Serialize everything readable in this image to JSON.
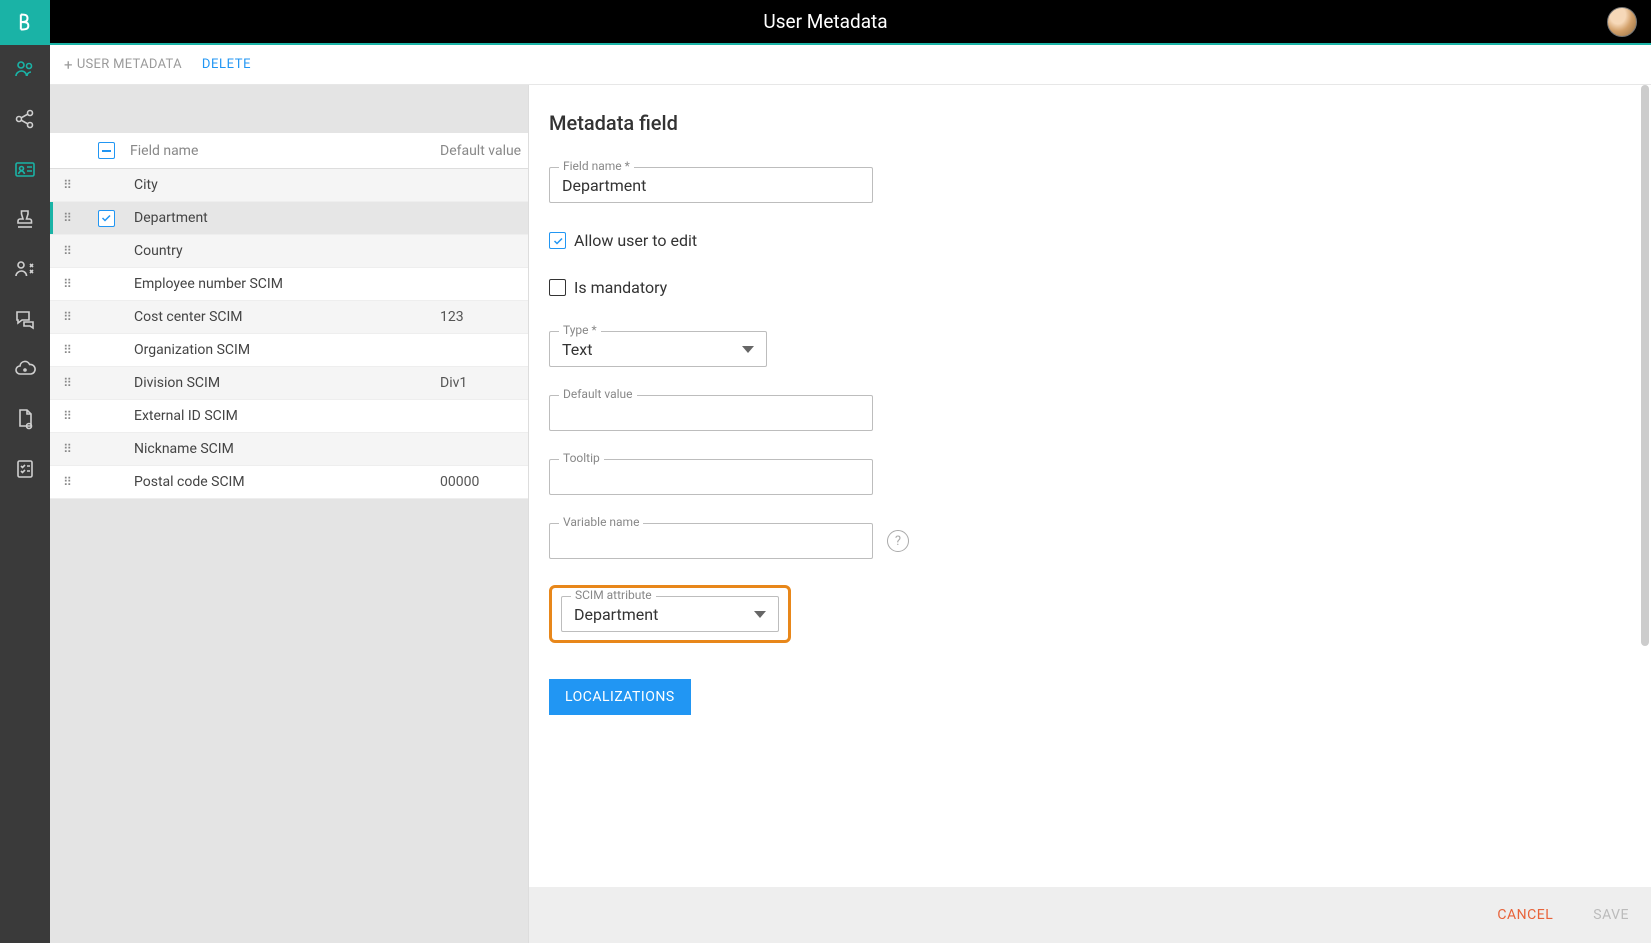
{
  "header": {
    "title": "User Metadata"
  },
  "toolbar": {
    "add_label": "USER METADATA",
    "delete_label": "DELETE"
  },
  "table": {
    "columns": {
      "field_name": "Field name",
      "default_value": "Default value"
    },
    "rows": [
      {
        "name": "City",
        "default": "",
        "selected": false
      },
      {
        "name": "Department",
        "default": "",
        "selected": true
      },
      {
        "name": "Country",
        "default": "",
        "selected": false
      },
      {
        "name": "Employee number SCIM",
        "default": "",
        "selected": false
      },
      {
        "name": "Cost center SCIM",
        "default": "123",
        "selected": false
      },
      {
        "name": "Organization SCIM",
        "default": "",
        "selected": false
      },
      {
        "name": "Division SCIM",
        "default": "Div1",
        "selected": false
      },
      {
        "name": "External ID SCIM",
        "default": "",
        "selected": false
      },
      {
        "name": "Nickname SCIM",
        "default": "",
        "selected": false
      },
      {
        "name": "Postal code SCIM",
        "default": "00000",
        "selected": false
      }
    ]
  },
  "detail": {
    "panel_title": "Metadata field",
    "field_name_label": "Field name *",
    "field_name_value": "Department",
    "allow_edit_label": "Allow user to edit",
    "allow_edit_checked": true,
    "is_mandatory_label": "Is mandatory",
    "is_mandatory_checked": false,
    "type_label": "Type *",
    "type_value": "Text",
    "default_value_label": "Default value",
    "default_value_value": "",
    "tooltip_label": "Tooltip",
    "tooltip_value": "",
    "variable_name_label": "Variable name",
    "variable_name_value": "",
    "scim_attribute_label": "SCIM attribute",
    "scim_attribute_value": "Department",
    "localizations_label": "LOCALIZATIONS",
    "cancel_label": "CANCEL",
    "save_label": "SAVE"
  }
}
